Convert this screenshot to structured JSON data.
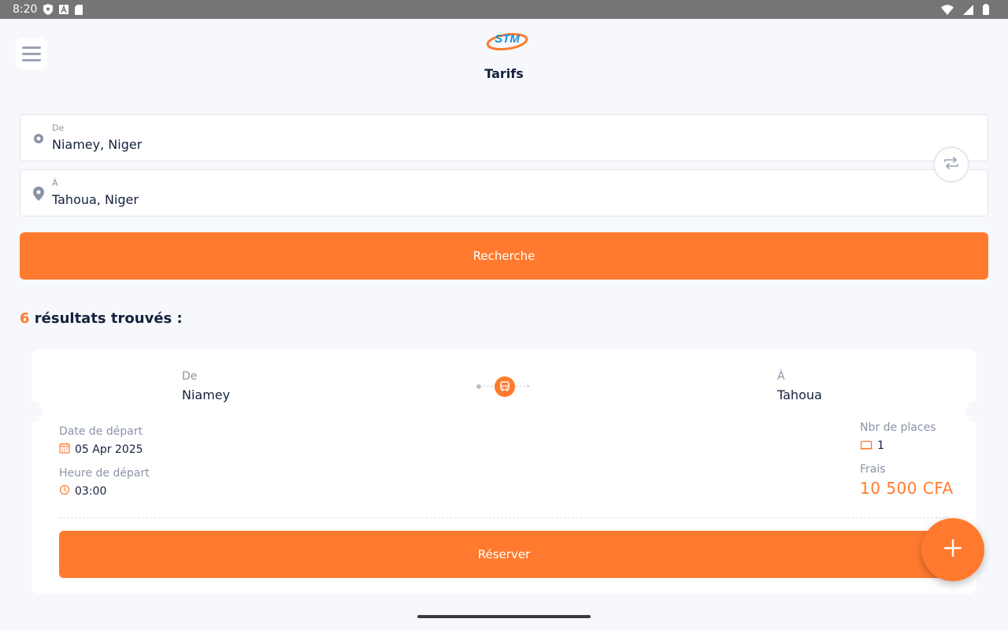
{
  "status_bar": {
    "time": "8:20",
    "icons": [
      "shield-icon",
      "a-icon",
      "sd-card-icon",
      "wifi-icon",
      "signal-icon",
      "battery-icon"
    ]
  },
  "header": {
    "logo_text": "STM",
    "title": "Tarifs"
  },
  "search": {
    "from": {
      "label": "De",
      "value": "Niamey, Niger",
      "icon": "origin-dot-icon"
    },
    "to": {
      "label": "À",
      "value": "Tahoua, Niger",
      "icon": "location-pin-icon"
    },
    "swap_icon": "swap-arrows-icon",
    "button_label": "Recherche"
  },
  "results": {
    "count": "6",
    "text": " résultats trouvés :"
  },
  "trip_card": {
    "from_label": "De",
    "from_city": "Niamey",
    "to_label": "À",
    "to_city": "Tahoua",
    "departure_date_label": "Date de départ",
    "departure_date": "05 Apr 2025",
    "departure_time_label": "Heure de départ",
    "departure_time": "03:00",
    "seats_label": "Nbr de places",
    "seats": "1",
    "fee_label": "Frais",
    "fee": "10 500 CFA",
    "book_label": "Réserver"
  },
  "colors": {
    "accent": "#ff7a2e",
    "text_dark": "#14213d",
    "text_muted": "#8a93a6",
    "background": "#f7f8fc"
  }
}
